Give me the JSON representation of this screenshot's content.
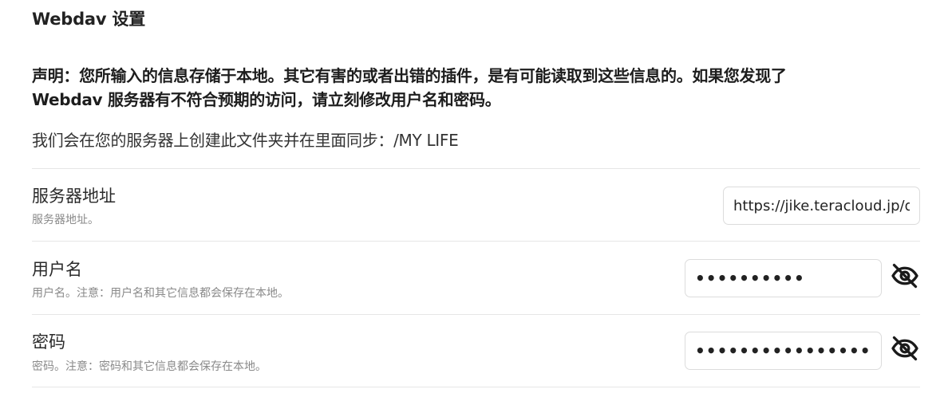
{
  "header": {
    "title": "Webdav 设置"
  },
  "notice": {
    "line1": "声明：您所输入的信息存储于本地。其它有害的或者出错的插件，是有可能读取到这些信息的。如果您发现了",
    "line2": "Webdav 服务器有不符合预期的访问，请立刻修改用户名和密码。"
  },
  "sync": {
    "text": "我们会在您的服务器上创建此文件夹并在里面同步：/MY LIFE"
  },
  "settings": {
    "server": {
      "name": "服务器地址",
      "desc": "服务器地址。",
      "value": "https://jike.teracloud.jp/dav/"
    },
    "username": {
      "name": "用户名",
      "desc": "用户名。注意：用户名和其它信息都会保存在本地。",
      "value": "••••••••••",
      "toggle_icon": "eye-off-icon"
    },
    "password": {
      "name": "密码",
      "desc": "密码。注意：密码和其它信息都会保存在本地。",
      "value": "••••••••••••••••",
      "toggle_icon": "eye-off-icon"
    }
  },
  "colors": {
    "text": "#222222",
    "muted": "#8a8a8a",
    "divider": "#e6e6e6",
    "input_border": "#dcdcdc"
  }
}
